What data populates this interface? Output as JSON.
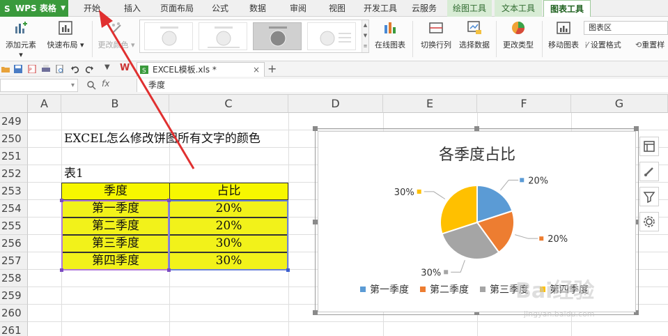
{
  "app": {
    "name": "WPS 表格"
  },
  "tabs": [
    {
      "label": "开始"
    },
    {
      "label": "插入"
    },
    {
      "label": "页面布局"
    },
    {
      "label": "公式"
    },
    {
      "label": "数据"
    },
    {
      "label": "审阅"
    },
    {
      "label": "视图"
    },
    {
      "label": "开发工具"
    },
    {
      "label": "云服务"
    },
    {
      "label": "绘图工具"
    },
    {
      "label": "文本工具"
    },
    {
      "label": "图表工具"
    }
  ],
  "ribbon": {
    "add_element": "添加元素",
    "quick_layout": "快速布局",
    "change_color": "更改颜色",
    "online_chart": "在线图表",
    "switch_row_col": "切换行列",
    "select_data": "选择数据",
    "change_type": "更改类型",
    "move_chart": "移动图表",
    "chart_area_select": "图表区",
    "format_settings": "设置格式",
    "reset": "重置样"
  },
  "doc_tab": {
    "name": "EXCEL模板.xls *"
  },
  "formula_bar": {
    "fx": "fx",
    "content": "季度"
  },
  "columns": [
    "A",
    "B",
    "C",
    "D",
    "E",
    "F",
    "G"
  ],
  "rows": [
    "249",
    "250",
    "251",
    "252",
    "253",
    "254",
    "255",
    "256",
    "257",
    "258",
    "259",
    "260",
    "261"
  ],
  "sheet": {
    "title_text": "EXCEL怎么修改饼图所有文字的颜色",
    "table_label": "表1",
    "table": {
      "headers": [
        "季度",
        "占比"
      ],
      "rows": [
        [
          "第一季度",
          "20%"
        ],
        [
          "第二季度",
          "20%"
        ],
        [
          "第三季度",
          "30%"
        ],
        [
          "第四季度",
          "30%"
        ]
      ]
    }
  },
  "chart_data": {
    "type": "pie",
    "title": "各季度占比",
    "categories": [
      "第一季度",
      "第二季度",
      "第三季度",
      "第四季度"
    ],
    "values": [
      20,
      20,
      30,
      30
    ],
    "labels": [
      "20%",
      "20%",
      "30%",
      "30%"
    ],
    "colors": [
      "#5b9bd5",
      "#ed7d31",
      "#a5a5a5",
      "#ffc000"
    ],
    "legend": "bottom"
  },
  "watermark": {
    "text": "Bai经验",
    "url": "jingyan.baidu.com"
  }
}
